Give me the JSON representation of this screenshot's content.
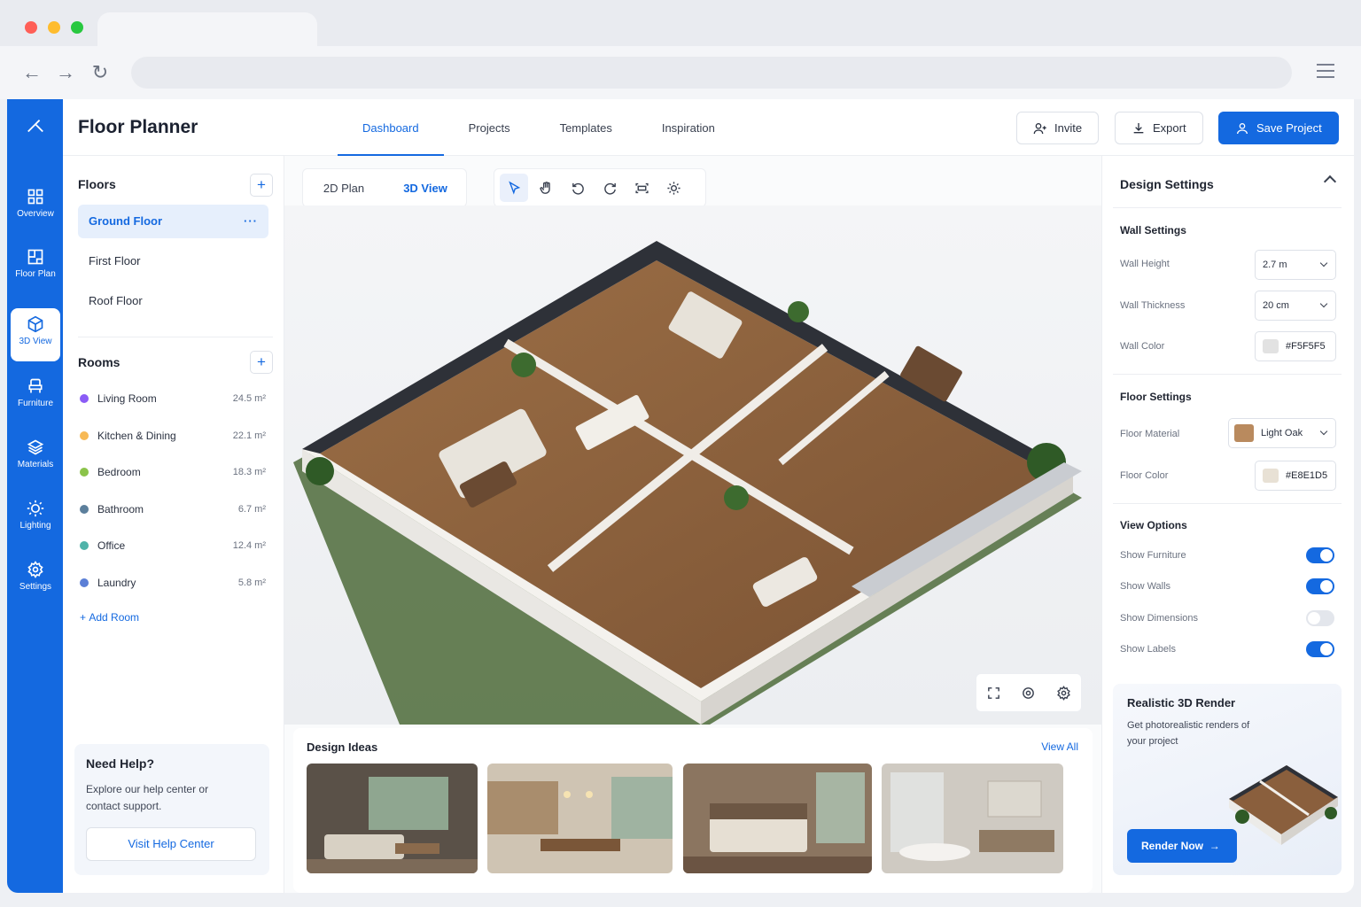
{
  "app": {
    "title": "Floor Planner"
  },
  "top_tabs": [
    {
      "label": "Dashboard"
    },
    {
      "label": "Projects"
    },
    {
      "label": "Templates"
    },
    {
      "label": "Inspiration"
    }
  ],
  "header_buttons": {
    "invite": "Invite",
    "export": "Export",
    "save": "Save Project"
  },
  "rail": [
    {
      "label": "Overview",
      "icon": "grid-icon"
    },
    {
      "label": "Floor Plan",
      "icon": "floor-plan-icon"
    },
    {
      "label": "3D View",
      "icon": "cube-icon"
    },
    {
      "label": "Furniture",
      "icon": "chair-icon"
    },
    {
      "label": "Materials",
      "icon": "layers-icon"
    },
    {
      "label": "Lighting",
      "icon": "sun-icon"
    },
    {
      "label": "Settings",
      "icon": "gear-icon"
    }
  ],
  "floors": {
    "title": "Floors",
    "items": [
      {
        "label": "Ground Floor"
      },
      {
        "label": "First Floor"
      },
      {
        "label": "Roof Floor"
      }
    ]
  },
  "rooms": {
    "title": "Rooms",
    "items": [
      {
        "name": "Living Room",
        "area": "24.5 m²",
        "color": "#8b5cf6"
      },
      {
        "name": "Kitchen & Dining",
        "area": "22.1 m²",
        "color": "#f7b955"
      },
      {
        "name": "Bedroom",
        "area": "18.3 m²",
        "color": "#8bc34a"
      },
      {
        "name": "Bathroom",
        "area": "6.7 m²",
        "color": "#5c7f9c"
      },
      {
        "name": "Office",
        "area": "12.4 m²",
        "color": "#4fb3a9"
      },
      {
        "name": "Laundry",
        "area": "5.8 m²",
        "color": "#5b7fd6"
      }
    ],
    "add_label": "Add Room"
  },
  "help": {
    "title": "Need Help?",
    "desc": "Explore our help center or contact support.",
    "button": "Visit Help Center"
  },
  "view_toggle": {
    "plan": "2D Plan",
    "view3d": "3D View"
  },
  "design_ideas": {
    "title": "Design Ideas",
    "view_all": "View All"
  },
  "design_settings": {
    "title": "Design Settings",
    "wall": {
      "title": "Wall Settings",
      "height_label": "Wall Height",
      "height_value": "2.7 m",
      "thickness_label": "Wall Thickness",
      "thickness_value": "20 cm",
      "color_label": "Wall Color",
      "color_value": "#F5F5F5"
    },
    "floor": {
      "title": "Floor Settings",
      "material_label": "Floor Material",
      "material_value": "Light Oak",
      "color_label": "Floor Color",
      "color_value": "#E8E1D5"
    },
    "view": {
      "title": "View Options",
      "options": [
        {
          "label": "Show Furniture",
          "on": true
        },
        {
          "label": "Show Walls",
          "on": true
        },
        {
          "label": "Show Dimensions",
          "on": false
        },
        {
          "label": "Show Labels",
          "on": true
        }
      ]
    }
  },
  "render": {
    "title": "Realistic 3D Render",
    "desc": "Get photorealistic renders of your project",
    "button": "Render Now"
  },
  "colors": {
    "accent": "#1469E0",
    "wall_chip": "#F5F5F5",
    "floor_chip": "#E8E1D5",
    "oak_chip": "#B98A5E"
  }
}
